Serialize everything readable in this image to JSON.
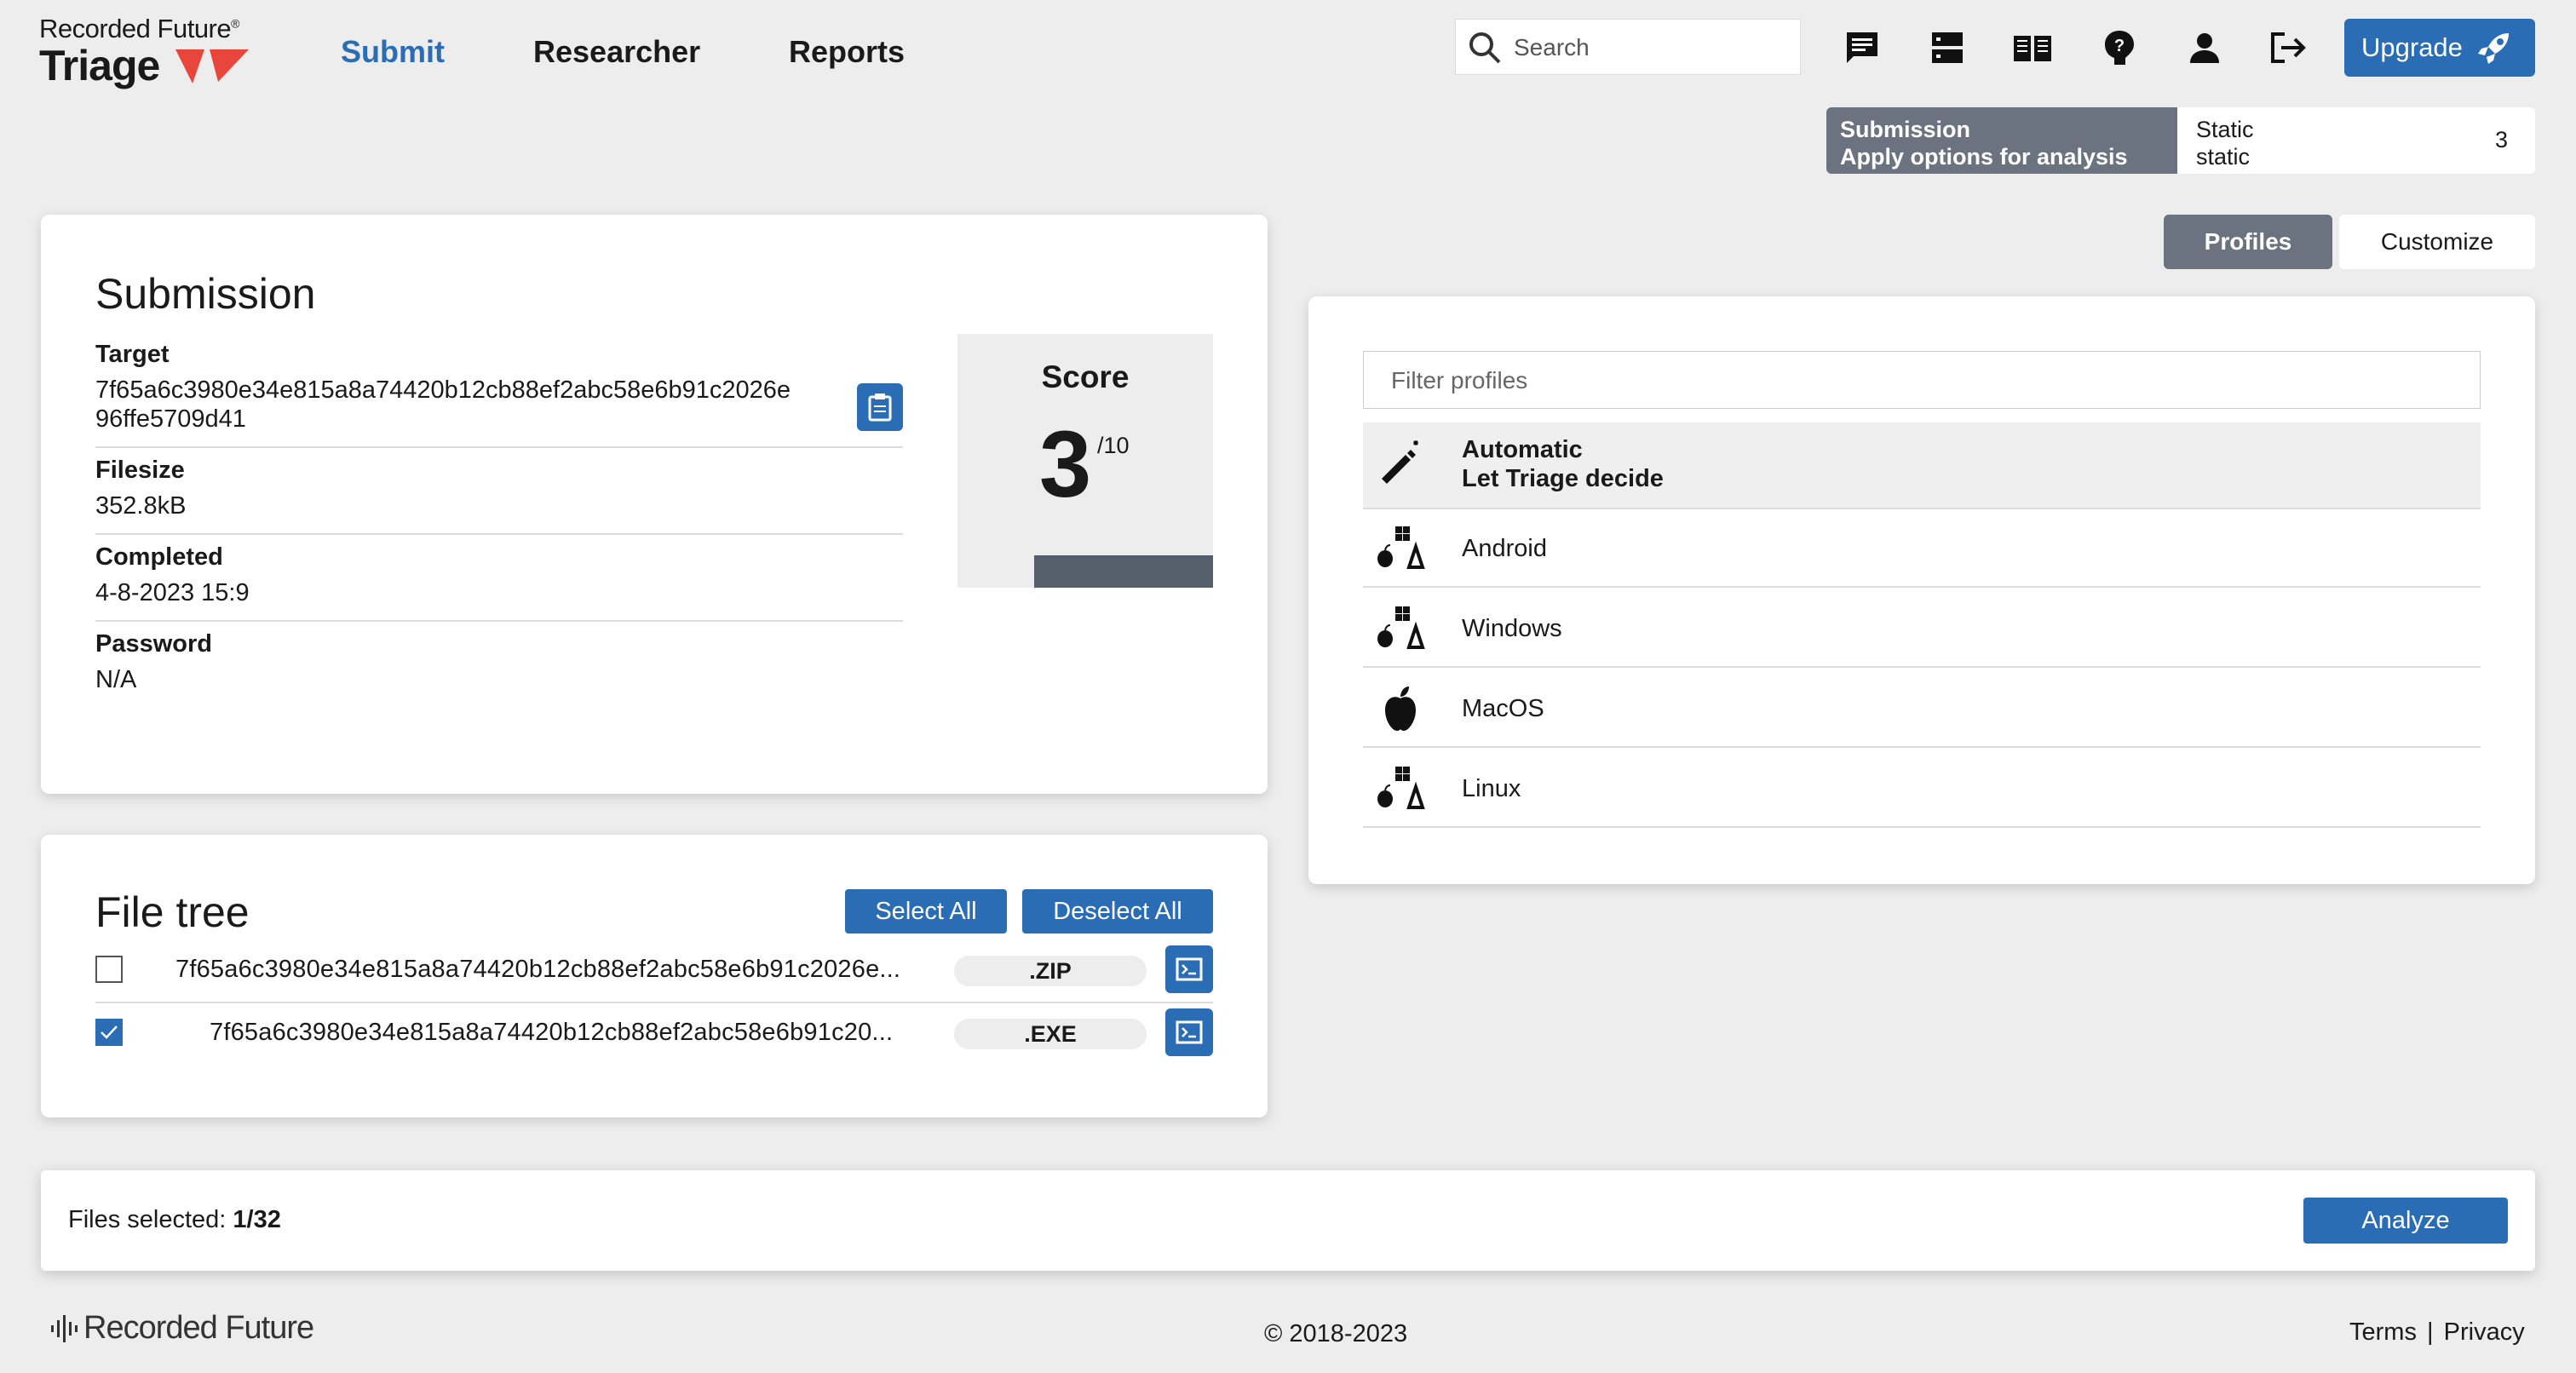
{
  "brand": {
    "top": "Recorded Future",
    "trademark": "®",
    "product": "Triage"
  },
  "nav": {
    "submit": "Submit",
    "researcher": "Researcher",
    "reports": "Reports"
  },
  "search": {
    "placeholder": "Search",
    "icon": "search-icon"
  },
  "header_icons": [
    "chat-icon",
    "server-icon",
    "book-icon",
    "help-icon",
    "user-icon",
    "logout-icon"
  ],
  "upgrade": {
    "label": "Upgrade",
    "icon": "rocket-icon"
  },
  "steps": {
    "submission": {
      "title": "Submission",
      "subtitle": "Apply options for analysis"
    },
    "static": {
      "title": "Static",
      "subtitle": "static",
      "count": "3"
    }
  },
  "profile_tabs": {
    "profiles": "Profiles",
    "customize": "Customize"
  },
  "submission": {
    "heading": "Submission",
    "target_label": "Target",
    "target_line1": "7f65a6c3980e34e815a8a74420b12cb88ef2abc58e6b91c2026e",
    "target_line2": "96ffe5709d41",
    "filesize_label": "Filesize",
    "filesize_value": "352.8kB",
    "completed_label": "Completed",
    "completed_value": "4-8-2023 15:9",
    "password_label": "Password",
    "password_value": "N/A"
  },
  "score": {
    "title": "Score",
    "value": "3",
    "max": "/10"
  },
  "file_tree": {
    "heading": "File tree",
    "select_all": "Select All",
    "deselect_all": "Deselect All",
    "files": [
      {
        "name": "7f65a6c3980e34e815a8a74420b12cb88ef2abc58e6b91c2026e...",
        "ext": ".ZIP",
        "checked": false
      },
      {
        "name": "7f65a6c3980e34e815a8a74420b12cb88ef2abc58e6b91c20...",
        "ext": ".EXE",
        "checked": true
      }
    ]
  },
  "profiles": {
    "filter_placeholder": "Filter profiles",
    "items": [
      {
        "name": "Automatic",
        "subtitle": "Let Triage decide",
        "icon": "magic-wand-icon"
      },
      {
        "name": "Android",
        "icon": "multi-os-icon"
      },
      {
        "name": "Windows",
        "icon": "multi-os-icon"
      },
      {
        "name": "MacOS",
        "icon": "apple-icon"
      },
      {
        "name": "Linux",
        "icon": "multi-os-icon"
      }
    ]
  },
  "bottom_bar": {
    "files_selected_label": "Files selected:",
    "files_selected_value": "1/32",
    "analyze": "Analyze"
  },
  "footer": {
    "logo": "Recorded Future",
    "copyright": "© 2018-2023",
    "terms": "Terms",
    "separator": "|",
    "privacy": "Privacy"
  },
  "colors": {
    "accent": "#2a6db5",
    "step_active": "#6b7280",
    "logo_red": "#e8463b"
  }
}
